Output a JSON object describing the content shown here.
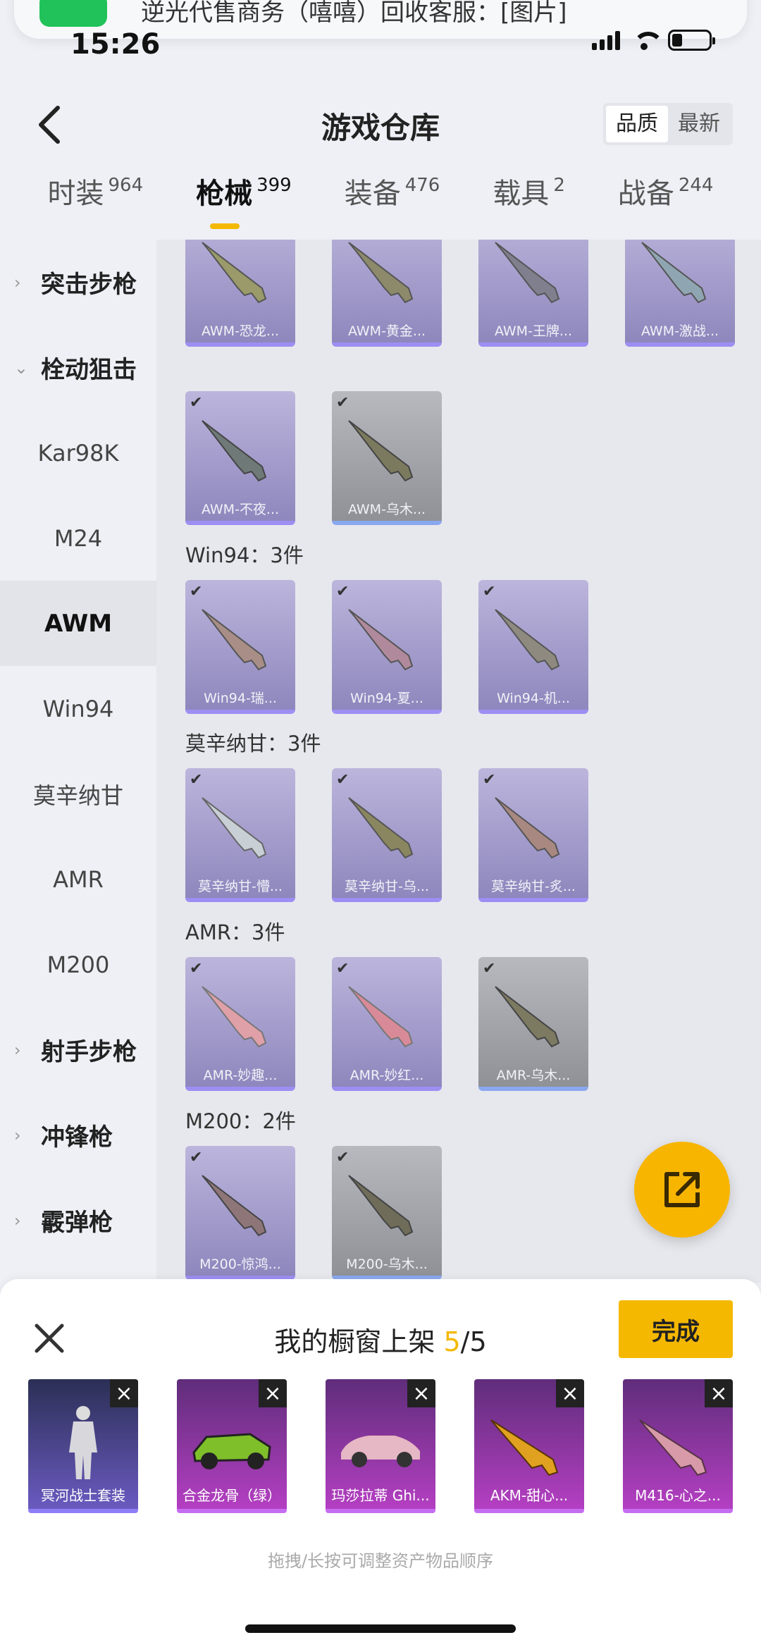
{
  "notification": {
    "text": "逆光代售商务（嘻嘻）回收客服：[图片]"
  },
  "status": {
    "time": "15:26"
  },
  "header": {
    "title": "游戏仓库",
    "sort": [
      "品质",
      "最新"
    ]
  },
  "tabs": [
    {
      "label": "时装",
      "count": "964"
    },
    {
      "label": "枪械",
      "count": "399"
    },
    {
      "label": "装备",
      "count": "476"
    },
    {
      "label": "载具",
      "count": "2"
    },
    {
      "label": "战备",
      "count": "244"
    }
  ],
  "sidebar": {
    "group_assault": "突击步枪",
    "group_bolt": "栓动狙击",
    "kar98k": "Kar98K",
    "m24": "M24",
    "awm": "AWM",
    "win94": "Win94",
    "mosin": "莫辛纳甘",
    "amr": "AMR",
    "m200": "M200",
    "group_dmr": "射手步枪",
    "group_smg": "冲锋枪",
    "group_shotgun": "霰弹枪"
  },
  "content": {
    "awm_row1": [
      "AWM-恐龙...",
      "AWM-黄金...",
      "AWM-王牌...",
      "AWM-激战..."
    ],
    "awm_row2": [
      "AWM-不夜...",
      "AWM-乌木..."
    ],
    "win94_title": "Win94：3件",
    "win94_items": [
      "Win94-瑞...",
      "Win94-夏...",
      "Win94-机..."
    ],
    "mosin_title": "莫辛纳甘：3件",
    "mosin_items": [
      "莫辛纳甘-懵...",
      "莫辛纳甘-乌...",
      "莫辛纳甘-炙..."
    ],
    "amr_title": "AMR：3件",
    "amr_items": [
      "AMR-妙趣...",
      "AMR-妙红...",
      "AMR-乌木..."
    ],
    "m200_title": "M200：2件",
    "m200_items": [
      "M200-惊鸿...",
      "M200-乌木..."
    ]
  },
  "panel": {
    "title": "我的橱窗上架",
    "count": "5",
    "total": "/5",
    "done": "完成",
    "items": [
      "冥河战士套装",
      "合金龙骨（绿）",
      "玛莎拉蒂 Ghi...",
      "AKM-甜心...",
      "M416-心之..."
    ],
    "hint": "拖拽/长按可调整资产物品顺序"
  },
  "icons": {
    "back": "chevron-left-icon",
    "share": "external-link-icon",
    "close": "close-icon",
    "check": "check-icon"
  },
  "colors": {
    "accent": "#f5b800",
    "purple_rarity": "#9d8ef3",
    "blue_rarity": "#8aa8f0"
  }
}
